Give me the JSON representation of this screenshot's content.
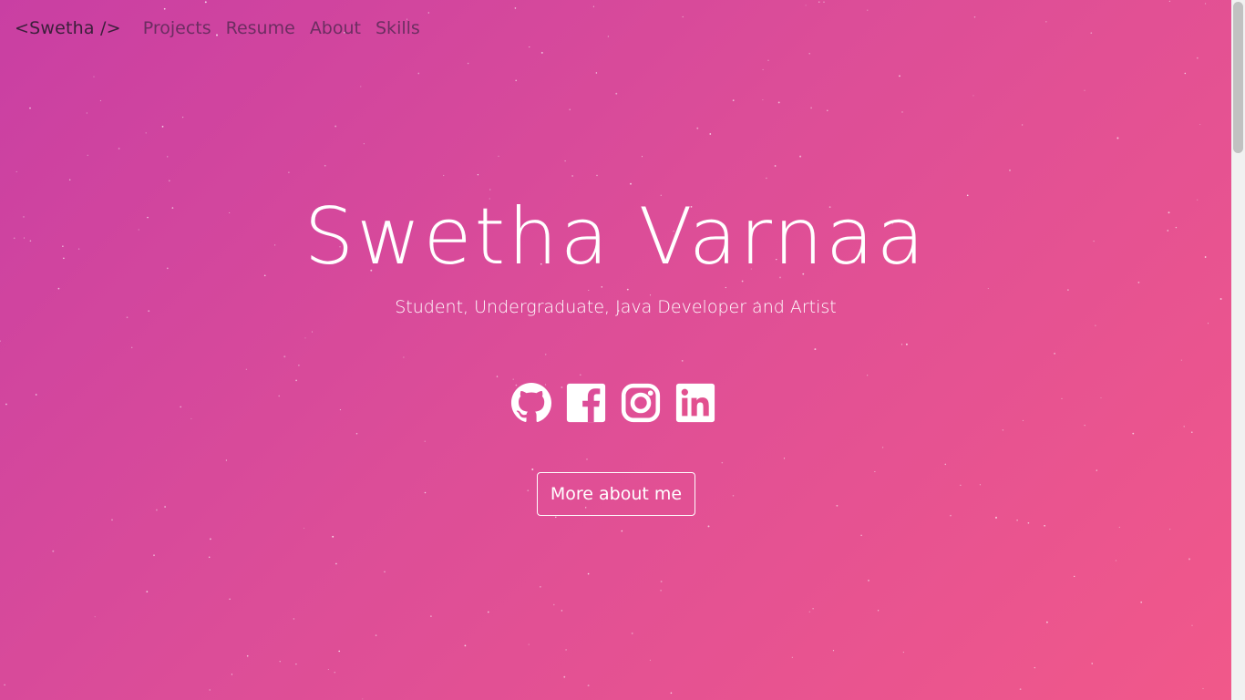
{
  "nav": {
    "brand": "<Swetha />",
    "links": [
      {
        "label": "Projects"
      },
      {
        "label": "Resume"
      },
      {
        "label": "About"
      },
      {
        "label": "Skills"
      }
    ]
  },
  "hero": {
    "title": "Swetha Varnaa",
    "subtitle": "Student, Undergraduate, Java Developer and Artist",
    "socials": [
      {
        "icon": "github-icon"
      },
      {
        "icon": "facebook-icon"
      },
      {
        "icon": "instagram-icon"
      },
      {
        "icon": "linkedin-icon"
      }
    ],
    "cta_label": "More about me"
  },
  "colors": {
    "gradient_start": "#c93fa3",
    "gradient_end": "#f1588a",
    "text": "#ffffff",
    "nav_text": "#5b2a57"
  }
}
